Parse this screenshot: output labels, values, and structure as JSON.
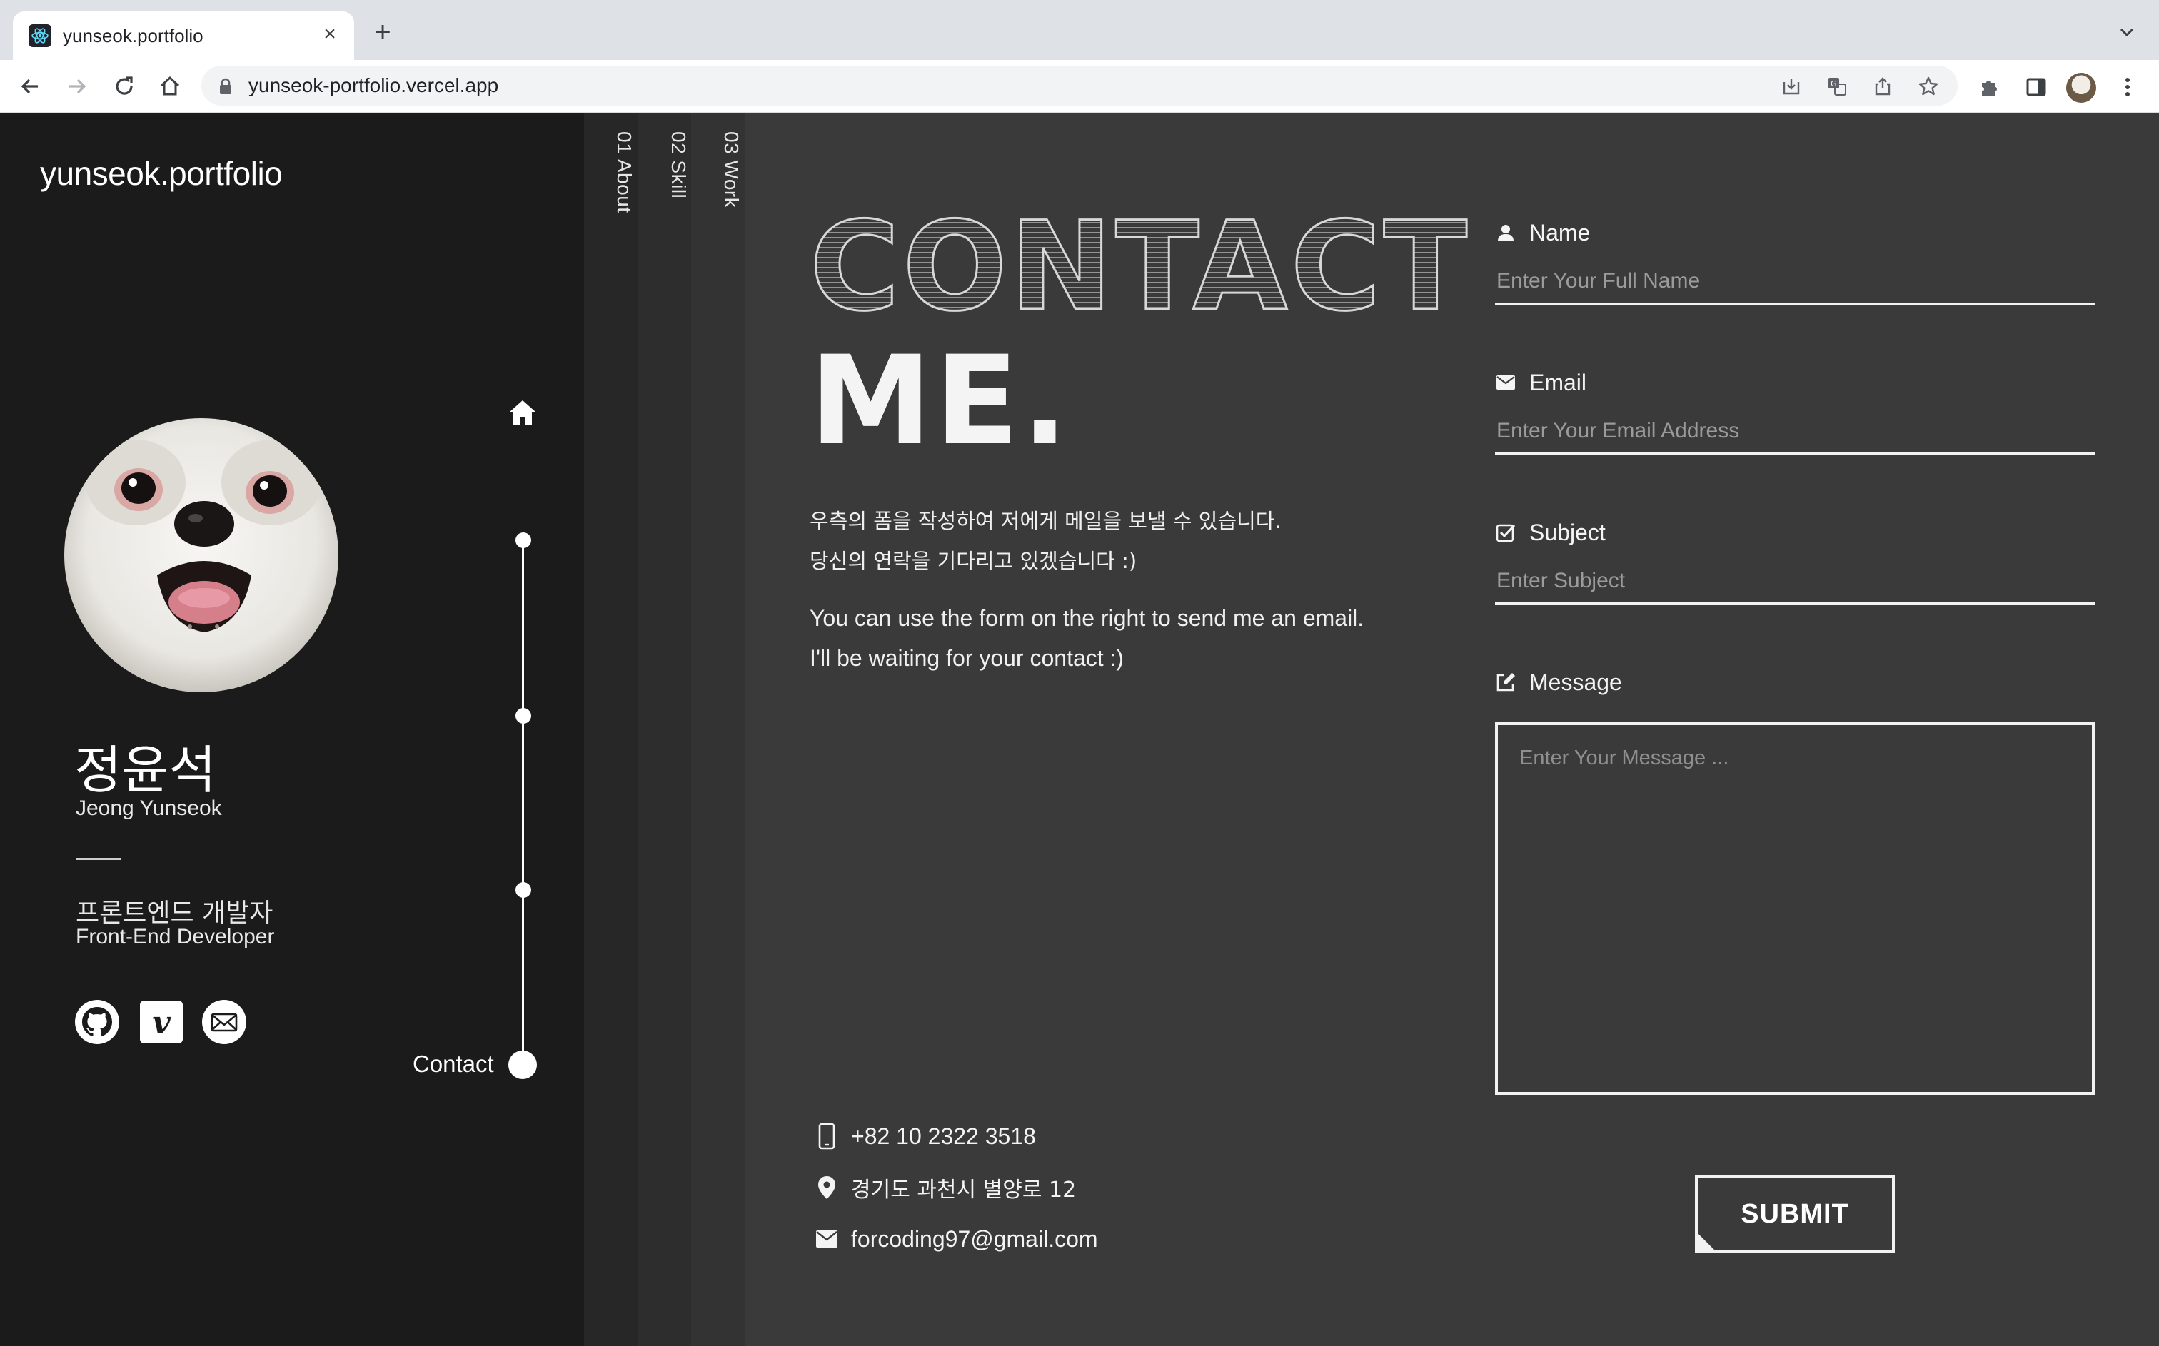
{
  "browser": {
    "tab_title": "yunseok.portfolio",
    "tab_close": "×",
    "new_tab": "+",
    "url": "yunseok-portfolio.vercel.app"
  },
  "sidebar": {
    "brand": "yunseok.portfolio",
    "name_ko": "정윤석",
    "name_en": "Jeong Yunseok",
    "role_ko": "프론트엔드 개발자",
    "role_en": "Front-End Developer",
    "social": [
      "github-icon",
      "vimeo-icon",
      "mail-icon"
    ],
    "vimeo_glyph": "v",
    "timeline_label": "Contact"
  },
  "section_tabs": [
    {
      "label": "01 About"
    },
    {
      "label": "02 Skill"
    },
    {
      "label": "03 Work"
    }
  ],
  "hero": {
    "line1": "CONTACT",
    "line2": "ME."
  },
  "description": {
    "ko_line1": "우측의 폼을 작성하여 저에게 메일을 보낼 수 있습니다.",
    "ko_line2": "당신의 연락을 기다리고 있겠습니다 :)",
    "en_line1": "You can use the form on the right to send me an email.",
    "en_line2": "I'll be waiting for your contact :)"
  },
  "contact_info": {
    "phone": "+82 10 2322 3518",
    "address": "경기도 과천시 별양로 12",
    "email": "forcoding97@gmail.com"
  },
  "form": {
    "name_label": "Name",
    "name_placeholder": "Enter Your Full Name",
    "email_label": "Email",
    "email_placeholder": "Enter Your Email Address",
    "subject_label": "Subject",
    "subject_placeholder": "Enter Subject",
    "message_label": "Message",
    "message_placeholder": "Enter Your Message ...",
    "submit_label": "SUBMIT"
  },
  "colors": {
    "sidebar_bg": "#1b1b1b",
    "main_bg": "#3a3a3a",
    "tab_strip_1": "#272727",
    "tab_strip_2": "#2d2d2d",
    "tab_strip_3": "#333333"
  }
}
